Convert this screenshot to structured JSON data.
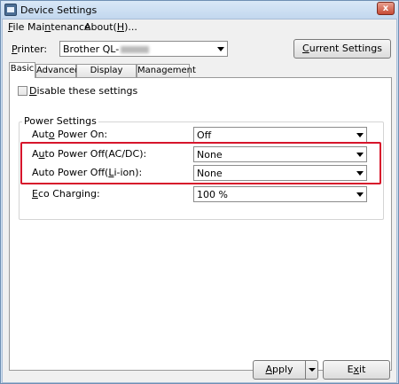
{
  "window": {
    "title": "Device Settings",
    "close_glyph": "x"
  },
  "menu": [
    {
      "label": "File",
      "hotkey": "F"
    },
    {
      "label": "Maintenance",
      "hotkey": "n"
    },
    {
      "label": "About(H)...",
      "hotkey": "H"
    }
  ],
  "printer": {
    "label": "Printer:",
    "value": "Brother QL-",
    "value_redacted": true
  },
  "current_settings_button": "Current Settings",
  "tabs": [
    {
      "label": "Basic",
      "active": true
    },
    {
      "label": "Advanced",
      "active": false
    },
    {
      "label": "Display Settings",
      "active": false
    },
    {
      "label": "Management",
      "active": false
    }
  ],
  "disable_settings": {
    "label": "Disable these settings",
    "checked": false
  },
  "power_settings": {
    "group_label": "Power Settings",
    "rows": [
      {
        "label": "Auto Power On:",
        "value": "Off"
      },
      {
        "label": "Auto Power Off(AC/DC):",
        "value": "None"
      },
      {
        "label": "Auto Power Off(Li-ion):",
        "value": "None"
      },
      {
        "label": "Eco Charging:",
        "value": "100 %"
      }
    ]
  },
  "footer": {
    "apply_label": "Apply",
    "exit_label": "Exit"
  },
  "colors": {
    "highlight_border": "#d7152b",
    "title_bar": "#cfe0f1"
  },
  "icons": [
    "app-icon",
    "close-icon",
    "dropdown-arrow-icon",
    "checkbox-icon"
  ]
}
